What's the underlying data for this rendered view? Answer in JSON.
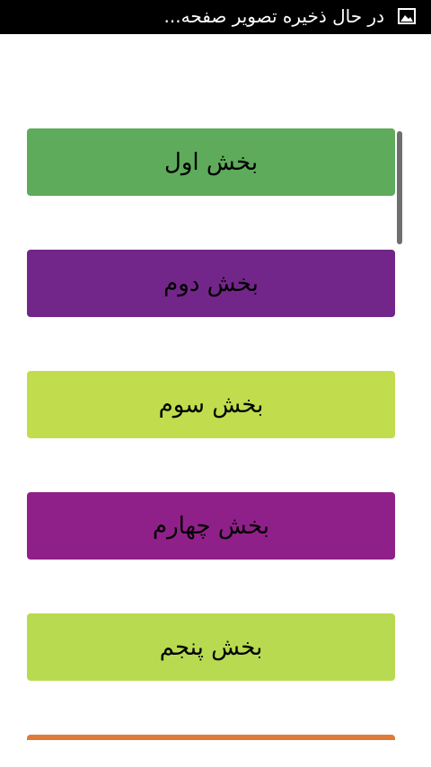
{
  "status_bar": {
    "icon": "image-icon",
    "text": "در حال ذخیره تصویر صفحه..."
  },
  "sections": [
    {
      "label": "بخش اول",
      "color": "#5eab5b"
    },
    {
      "label": "بخش دوم",
      "color": "#732689"
    },
    {
      "label": "بخش سوم",
      "color": "#c1dd4d"
    },
    {
      "label": "بخش چهارم",
      "color": "#902089"
    },
    {
      "label": "بخش پنجم",
      "color": "#b8da51"
    },
    {
      "label": "",
      "color": "#e07a38"
    }
  ]
}
